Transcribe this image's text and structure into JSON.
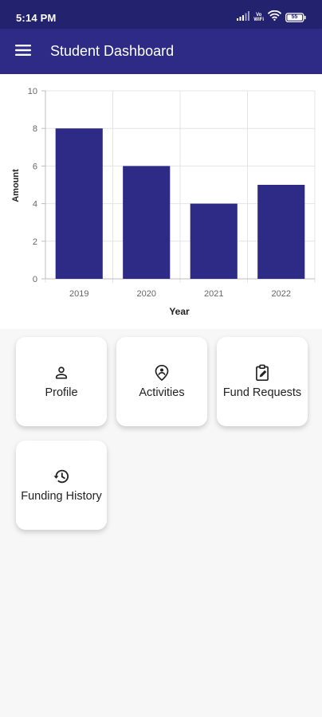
{
  "status_bar": {
    "time": "5:14 PM",
    "vowifi_top": "Vo",
    "vowifi_bottom": "WiFi",
    "battery": "55",
    "icons": [
      "signal-icon",
      "vowifi-icon",
      "wifi-icon",
      "battery-icon"
    ]
  },
  "app_bar": {
    "title": "Student Dashboard",
    "menu_icon": "menu-icon"
  },
  "chart_data": {
    "type": "bar",
    "categories": [
      "2019",
      "2020",
      "2021",
      "2022"
    ],
    "values": [
      8,
      6,
      4,
      5
    ],
    "xlabel": "Year",
    "ylabel": "Amount",
    "ylim": [
      0,
      10
    ],
    "yticks": [
      "0",
      "2",
      "4",
      "6",
      "8",
      "10"
    ],
    "grid": true,
    "bar_color": "#2d2b86"
  },
  "tiles": [
    {
      "label": "Profile",
      "icon": "person-icon"
    },
    {
      "label": "Activities",
      "icon": "location-person-icon"
    },
    {
      "label": "Fund Requests",
      "icon": "clipboard-edit-icon"
    },
    {
      "label": "Funding History",
      "icon": "history-icon"
    }
  ],
  "colors": {
    "primary": "#2d2b86",
    "status_bar": "#23226e",
    "background": "#f7f7f7"
  }
}
